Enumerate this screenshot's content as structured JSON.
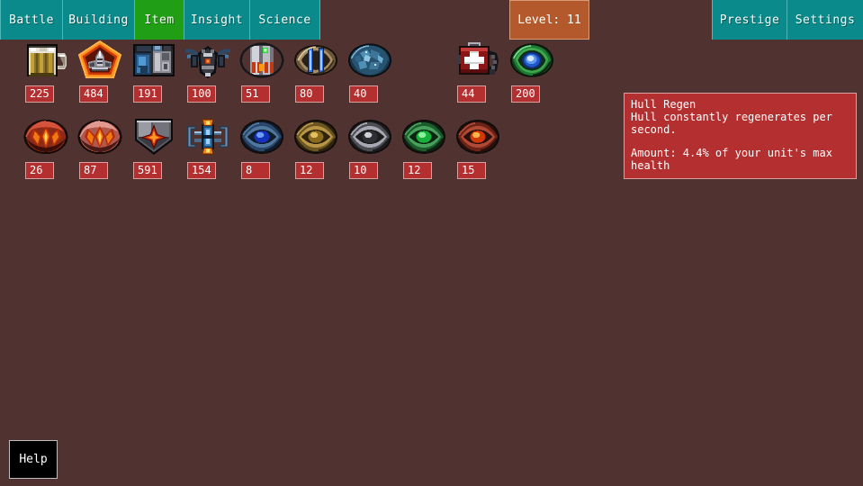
{
  "topbar": {
    "left_tabs": [
      {
        "label": "Battle",
        "name": "tab-battle",
        "active": false
      },
      {
        "label": "Building",
        "name": "tab-building",
        "active": false
      },
      {
        "label": "Item",
        "name": "tab-item",
        "active": true
      },
      {
        "label": "Insight",
        "name": "tab-insight",
        "active": false
      },
      {
        "label": "Science",
        "name": "tab-science",
        "active": false
      }
    ],
    "right_tabs": [
      {
        "label": "Prestige",
        "name": "tab-prestige"
      },
      {
        "label": "Settings",
        "name": "tab-settings"
      }
    ],
    "level_label": "Level: 11"
  },
  "items": {
    "row1": [
      {
        "count": "225",
        "icon": "beer-mug-icon",
        "empty": false
      },
      {
        "count": "484",
        "icon": "orange-shield-crest-icon",
        "empty": false
      },
      {
        "count": "191",
        "icon": "blue-machinery-crate-icon",
        "empty": false
      },
      {
        "count": "100",
        "icon": "dark-winged-drone-icon",
        "empty": false
      },
      {
        "count": "51",
        "icon": "silver-capsule-icon",
        "empty": false
      },
      {
        "count": "80",
        "icon": "blue-twin-bars-icon",
        "empty": false
      },
      {
        "count": "40",
        "icon": "blue-ore-rock-icon",
        "empty": false
      },
      {
        "count": "",
        "icon": "",
        "empty": true
      },
      {
        "count": "44",
        "icon": "red-medkit-icon",
        "empty": false
      },
      {
        "count": "200",
        "icon": "green-blue-orb-icon",
        "empty": false
      }
    ],
    "row2": [
      {
        "count": "26",
        "icon": "red-flame-pod-icon",
        "empty": false
      },
      {
        "count": "87",
        "icon": "pink-flame-pod-icon",
        "empty": false
      },
      {
        "count": "591",
        "icon": "red-star-shield-icon",
        "empty": false
      },
      {
        "count": "154",
        "icon": "blue-reactor-clamp-icon",
        "empty": false
      },
      {
        "count": "8",
        "icon": "blue-gem-disc-icon",
        "empty": false
      },
      {
        "count": "12",
        "icon": "gold-gem-disc-icon",
        "empty": false
      },
      {
        "count": "10",
        "icon": "silver-gem-disc-icon",
        "empty": false
      },
      {
        "count": "12",
        "icon": "green-gem-disc-icon",
        "empty": false
      },
      {
        "count": "15",
        "icon": "red-gem-disc-icon",
        "empty": false
      }
    ]
  },
  "tooltip": {
    "title": "Hull Regen",
    "description": "Hull constantly regenerates per second.",
    "amount": "Amount: 4.4% of your unit's max health"
  },
  "help": {
    "label": "Help"
  },
  "colors": {
    "background": "#503231",
    "tab": "#0a8a8a",
    "tab_active": "#1f9e16",
    "tab_border": "#4fb8b8",
    "level_box": "#b4592b",
    "panel_red": "#b42f2f",
    "panel_border": "#d9a0a0",
    "text": "#ffffff"
  }
}
